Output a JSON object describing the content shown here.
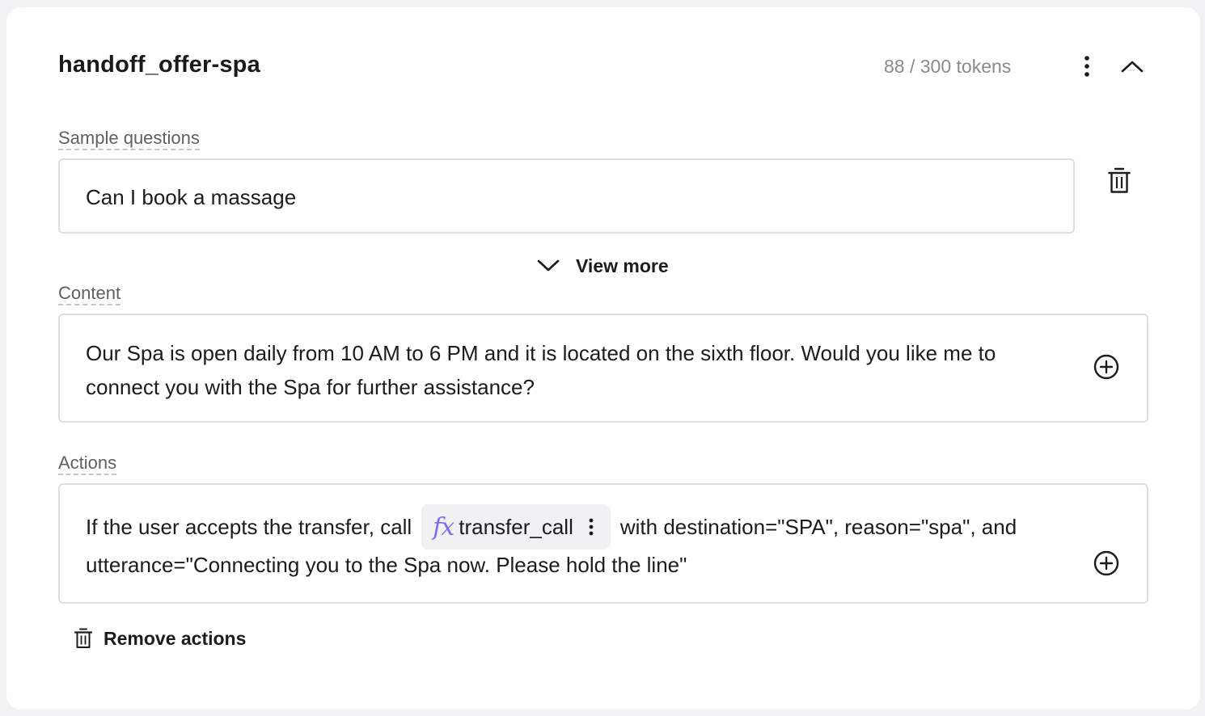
{
  "header": {
    "title": "handoff_offer-spa",
    "tokens": "88 / 300 tokens",
    "menu_icon": "vertical-dots-icon",
    "collapse_icon": "chevron-up-icon"
  },
  "sample_questions": {
    "label": "Sample questions",
    "items": [
      "Can I book a massage"
    ],
    "delete_icon": "trash-icon",
    "view_more_label": "View more"
  },
  "content": {
    "label": "Content",
    "text": "Our Spa is open daily from 10 AM to 6 PM and it is located on the sixth floor. Would you like me to connect you with the Spa for further assistance?",
    "add_icon": "circle-plus-icon"
  },
  "actions": {
    "label": "Actions",
    "text_before": "If the user accepts the transfer, call",
    "function": {
      "icon_text": "fx",
      "name": "transfer_call"
    },
    "text_after": "with destination=\"SPA\", reason=\"spa\", and",
    "text_line2": "utterance=\"Connecting you to the Spa now. Please hold the line\"",
    "add_icon": "circle-plus-icon",
    "remove_label": "Remove actions"
  },
  "colors": {
    "accent_fx": "#7c6cf0",
    "border": "#dedee2",
    "muted_text": "#8a8a8e",
    "background": "#f2f2f4"
  }
}
